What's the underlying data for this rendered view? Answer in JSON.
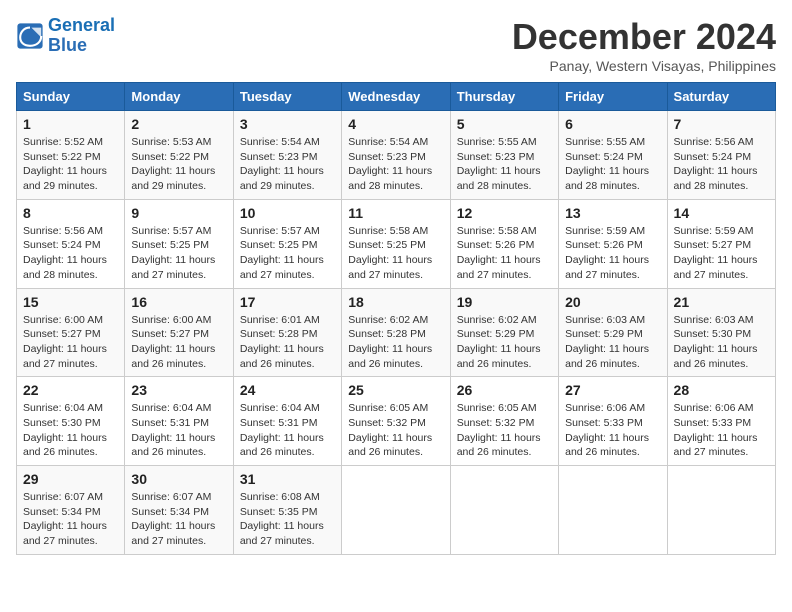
{
  "header": {
    "logo_line1": "General",
    "logo_line2": "Blue",
    "month": "December 2024",
    "location": "Panay, Western Visayas, Philippines"
  },
  "days_of_week": [
    "Sunday",
    "Monday",
    "Tuesday",
    "Wednesday",
    "Thursday",
    "Friday",
    "Saturday"
  ],
  "weeks": [
    [
      {
        "day": 1,
        "info": "Sunrise: 5:52 AM\nSunset: 5:22 PM\nDaylight: 11 hours\nand 29 minutes."
      },
      {
        "day": 2,
        "info": "Sunrise: 5:53 AM\nSunset: 5:22 PM\nDaylight: 11 hours\nand 29 minutes."
      },
      {
        "day": 3,
        "info": "Sunrise: 5:54 AM\nSunset: 5:23 PM\nDaylight: 11 hours\nand 29 minutes."
      },
      {
        "day": 4,
        "info": "Sunrise: 5:54 AM\nSunset: 5:23 PM\nDaylight: 11 hours\nand 28 minutes."
      },
      {
        "day": 5,
        "info": "Sunrise: 5:55 AM\nSunset: 5:23 PM\nDaylight: 11 hours\nand 28 minutes."
      },
      {
        "day": 6,
        "info": "Sunrise: 5:55 AM\nSunset: 5:24 PM\nDaylight: 11 hours\nand 28 minutes."
      },
      {
        "day": 7,
        "info": "Sunrise: 5:56 AM\nSunset: 5:24 PM\nDaylight: 11 hours\nand 28 minutes."
      }
    ],
    [
      {
        "day": 8,
        "info": "Sunrise: 5:56 AM\nSunset: 5:24 PM\nDaylight: 11 hours\nand 28 minutes."
      },
      {
        "day": 9,
        "info": "Sunrise: 5:57 AM\nSunset: 5:25 PM\nDaylight: 11 hours\nand 27 minutes."
      },
      {
        "day": 10,
        "info": "Sunrise: 5:57 AM\nSunset: 5:25 PM\nDaylight: 11 hours\nand 27 minutes."
      },
      {
        "day": 11,
        "info": "Sunrise: 5:58 AM\nSunset: 5:25 PM\nDaylight: 11 hours\nand 27 minutes."
      },
      {
        "day": 12,
        "info": "Sunrise: 5:58 AM\nSunset: 5:26 PM\nDaylight: 11 hours\nand 27 minutes."
      },
      {
        "day": 13,
        "info": "Sunrise: 5:59 AM\nSunset: 5:26 PM\nDaylight: 11 hours\nand 27 minutes."
      },
      {
        "day": 14,
        "info": "Sunrise: 5:59 AM\nSunset: 5:27 PM\nDaylight: 11 hours\nand 27 minutes."
      }
    ],
    [
      {
        "day": 15,
        "info": "Sunrise: 6:00 AM\nSunset: 5:27 PM\nDaylight: 11 hours\nand 27 minutes."
      },
      {
        "day": 16,
        "info": "Sunrise: 6:00 AM\nSunset: 5:27 PM\nDaylight: 11 hours\nand 26 minutes."
      },
      {
        "day": 17,
        "info": "Sunrise: 6:01 AM\nSunset: 5:28 PM\nDaylight: 11 hours\nand 26 minutes."
      },
      {
        "day": 18,
        "info": "Sunrise: 6:02 AM\nSunset: 5:28 PM\nDaylight: 11 hours\nand 26 minutes."
      },
      {
        "day": 19,
        "info": "Sunrise: 6:02 AM\nSunset: 5:29 PM\nDaylight: 11 hours\nand 26 minutes."
      },
      {
        "day": 20,
        "info": "Sunrise: 6:03 AM\nSunset: 5:29 PM\nDaylight: 11 hours\nand 26 minutes."
      },
      {
        "day": 21,
        "info": "Sunrise: 6:03 AM\nSunset: 5:30 PM\nDaylight: 11 hours\nand 26 minutes."
      }
    ],
    [
      {
        "day": 22,
        "info": "Sunrise: 6:04 AM\nSunset: 5:30 PM\nDaylight: 11 hours\nand 26 minutes."
      },
      {
        "day": 23,
        "info": "Sunrise: 6:04 AM\nSunset: 5:31 PM\nDaylight: 11 hours\nand 26 minutes."
      },
      {
        "day": 24,
        "info": "Sunrise: 6:04 AM\nSunset: 5:31 PM\nDaylight: 11 hours\nand 26 minutes."
      },
      {
        "day": 25,
        "info": "Sunrise: 6:05 AM\nSunset: 5:32 PM\nDaylight: 11 hours\nand 26 minutes."
      },
      {
        "day": 26,
        "info": "Sunrise: 6:05 AM\nSunset: 5:32 PM\nDaylight: 11 hours\nand 26 minutes."
      },
      {
        "day": 27,
        "info": "Sunrise: 6:06 AM\nSunset: 5:33 PM\nDaylight: 11 hours\nand 26 minutes."
      },
      {
        "day": 28,
        "info": "Sunrise: 6:06 AM\nSunset: 5:33 PM\nDaylight: 11 hours\nand 27 minutes."
      }
    ],
    [
      {
        "day": 29,
        "info": "Sunrise: 6:07 AM\nSunset: 5:34 PM\nDaylight: 11 hours\nand 27 minutes."
      },
      {
        "day": 30,
        "info": "Sunrise: 6:07 AM\nSunset: 5:34 PM\nDaylight: 11 hours\nand 27 minutes."
      },
      {
        "day": 31,
        "info": "Sunrise: 6:08 AM\nSunset: 5:35 PM\nDaylight: 11 hours\nand 27 minutes."
      },
      {
        "day": null,
        "info": ""
      },
      {
        "day": null,
        "info": ""
      },
      {
        "day": null,
        "info": ""
      },
      {
        "day": null,
        "info": ""
      }
    ]
  ]
}
